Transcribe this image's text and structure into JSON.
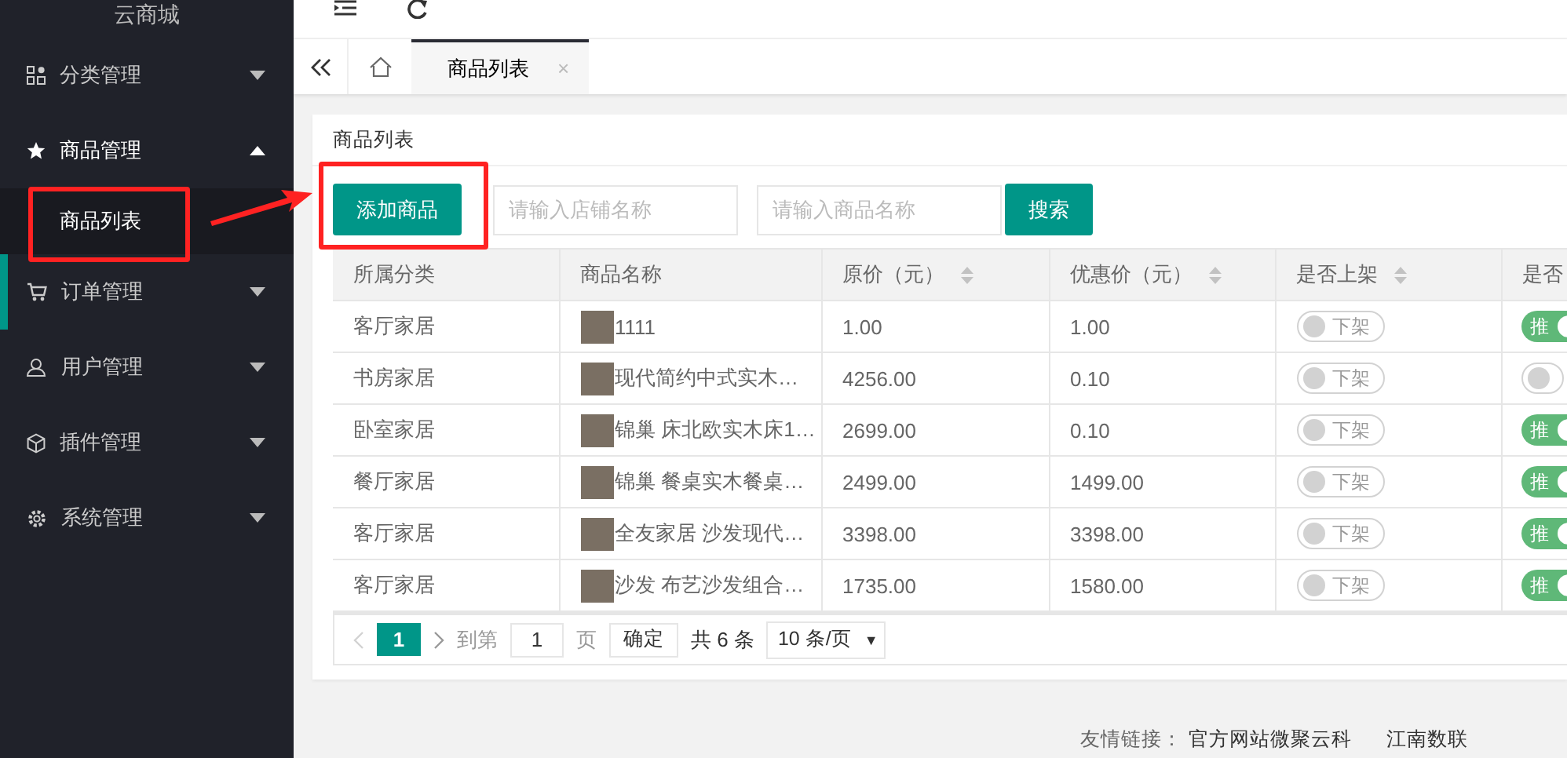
{
  "sidebar": {
    "title": "云商城",
    "items": [
      {
        "label": "分类管理",
        "expanded": false,
        "selected": false
      },
      {
        "label": "商品管理",
        "expanded": true,
        "selected": false,
        "children": [
          {
            "label": "商品列表",
            "selected": true
          }
        ]
      },
      {
        "label": "订单管理",
        "expanded": false,
        "selected": true
      },
      {
        "label": "用户管理",
        "expanded": false,
        "selected": false
      },
      {
        "label": "插件管理",
        "expanded": false,
        "selected": false
      },
      {
        "label": "系统管理",
        "expanded": false,
        "selected": false
      }
    ]
  },
  "tabs": [
    {
      "label": "商品列表",
      "selected": true,
      "close": "×"
    }
  ],
  "card": {
    "title": "商品列表",
    "toolbar": {
      "add_button": "添加商品",
      "shop_search": {
        "placeholder": "请输入店铺名称"
      },
      "product_search": {
        "placeholder": "请输入商品名称"
      },
      "search_button": "搜索"
    },
    "table": {
      "columns": [
        {
          "label": "所属分类",
          "sortable": false
        },
        {
          "label": "商品名称",
          "sortable": false
        },
        {
          "label": "原价（元）",
          "sortable": true
        },
        {
          "label": "优惠价（元）",
          "sortable": true
        },
        {
          "label": "是否上架",
          "sortable": true
        },
        {
          "label": "是否"
        }
      ],
      "rows": [
        {
          "category": "客厅家居",
          "name": "1111",
          "price": "1.00",
          "sale": "1.00",
          "listed": {
            "on": false,
            "text": "下架"
          },
          "recommend": {
            "on": true,
            "text": "推"
          }
        },
        {
          "category": "书房家居",
          "name": "现代简约中式实木…",
          "price": "4256.00",
          "sale": "0.10",
          "listed": {
            "on": false,
            "text": "下架"
          },
          "recommend": {
            "on": false
          }
        },
        {
          "category": "卧室家居",
          "name": "锦巢 床北欧实木床1…",
          "price": "2699.00",
          "sale": "0.10",
          "listed": {
            "on": false,
            "text": "下架"
          },
          "recommend": {
            "on": true,
            "text": "推"
          }
        },
        {
          "category": "餐厅家居",
          "name": "锦巢 餐桌实木餐桌…",
          "price": "2499.00",
          "sale": "1499.00",
          "listed": {
            "on": false,
            "text": "下架"
          },
          "recommend": {
            "on": true,
            "text": "推"
          }
        },
        {
          "category": "客厅家居",
          "name": "全友家居 沙发现代…",
          "price": "3398.00",
          "sale": "3398.00",
          "listed": {
            "on": false,
            "text": "下架"
          },
          "recommend": {
            "on": true,
            "text": "推"
          }
        },
        {
          "category": "客厅家居",
          "name": "沙发 布艺沙发组合…",
          "price": "1735.00",
          "sale": "1580.00",
          "listed": {
            "on": false,
            "text": "下架"
          },
          "recommend": {
            "on": true,
            "text": "推"
          }
        }
      ]
    },
    "pager": {
      "pages": [
        {
          "label": "1",
          "selected": true
        }
      ],
      "goto_label": "到第",
      "goto_value": "1",
      "page_unit": "页",
      "confirm": "确定",
      "total": "共 6 条",
      "page_size": "10 条/页",
      "caret": "▼"
    }
  },
  "footer": {
    "label": "友情链接：",
    "links": [
      "官方网站微聚云科",
      "江南数联"
    ]
  }
}
